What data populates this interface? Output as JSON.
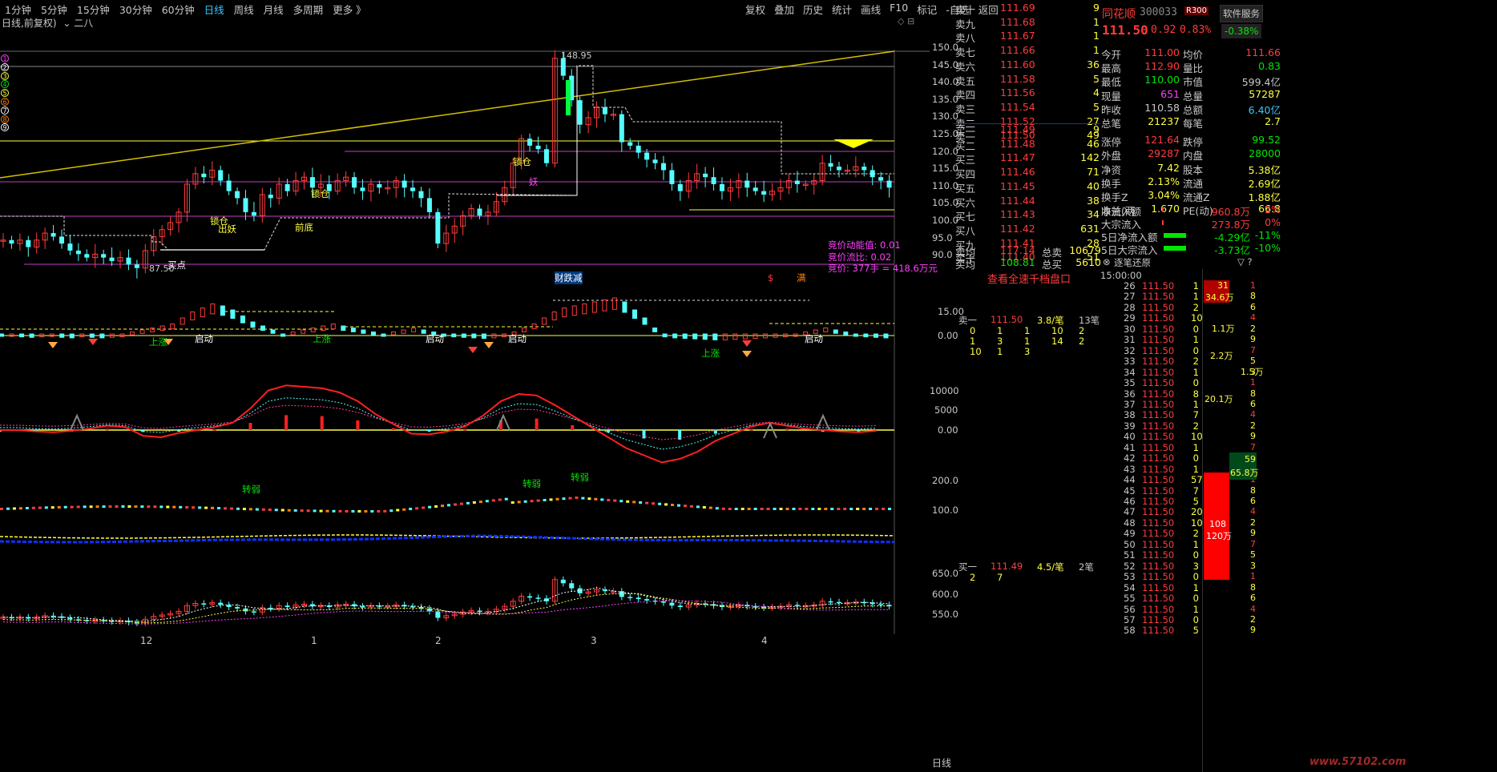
{
  "periods": [
    "1分钟",
    "5分钟",
    "15分钟",
    "30分钟",
    "60分钟",
    "日线",
    "周线",
    "月线",
    "多周期",
    "更多 》"
  ],
  "active_period": "日线",
  "right_tools": [
    "复权",
    "叠加",
    "历史",
    "统计",
    "画线",
    "F10",
    "标记",
    "-自选",
    "返回"
  ],
  "subtitle": "日线,前复权)",
  "formula": "二八",
  "main_y": [
    "150.0",
    "145.0",
    "140.0",
    "135.0",
    "130.0",
    "125.0",
    "120.0",
    "115.0",
    "110.0",
    "105.0",
    "100.0",
    "95.0",
    "90.0"
  ],
  "ind1_y": [
    "15.00",
    "0.00"
  ],
  "ind2_y": [
    "10000",
    "5000",
    "0.00"
  ],
  "ind3_y": [
    "200.0",
    "100.0"
  ],
  "ind4_y": [
    "650.0",
    "600.0",
    "550.0"
  ],
  "x_labels": [
    "12",
    "1",
    "2",
    "3",
    "4"
  ],
  "bottom_label": "日线",
  "numbers_legend": [
    "1",
    "2",
    "3",
    "4",
    "5",
    "6",
    "7",
    "8",
    "9"
  ],
  "annotations": {
    "high_price": "148.95",
    "low_price": "87.50",
    "buy_point": "买点",
    "lock1": "锁仓",
    "out1": "出妖",
    "front_bottom": "前底",
    "lock2": "锁仓",
    "lock3": "锁仓",
    "qiyao": "妖",
    "ind_energy": "竞价动能值: 0.01",
    "ind_ratio": "竞价流比: 0.02",
    "ind_amount": "竞价: 377手 = 418.6万元",
    "caitiao": "财跌减",
    "s_mark": "$",
    "dian": "满",
    "start1": "启动",
    "start2": "启动",
    "start3": "启动",
    "start4": "启动",
    "up": "上涨",
    "zhuanruo": "转弱"
  },
  "sell_rows": [
    {
      "label": "卖十",
      "price": "111.69",
      "vol": "9"
    },
    {
      "label": "卖九",
      "price": "111.68",
      "vol": "1"
    },
    {
      "label": "卖八",
      "price": "111.67",
      "vol": "1"
    },
    {
      "label": "卖七",
      "price": "111.66",
      "vol": "1"
    },
    {
      "label": "卖六",
      "price": "111.60",
      "vol": "36"
    },
    {
      "label": "卖五",
      "price": "111.58",
      "vol": "5"
    },
    {
      "label": "卖四",
      "price": "111.56",
      "vol": "4"
    },
    {
      "label": "卖三",
      "price": "111.54",
      "vol": "5"
    },
    {
      "label": "卖二",
      "price": "111.52",
      "vol": "27"
    },
    {
      "label": "卖一",
      "price": "111.50",
      "vol": "49"
    }
  ],
  "buy_rows": [
    {
      "label": "买一",
      "price": "111.49",
      "vol": "9"
    },
    {
      "label": "买二",
      "price": "111.48",
      "vol": "46"
    },
    {
      "label": "买三",
      "price": "111.47",
      "vol": "142"
    },
    {
      "label": "买四",
      "price": "111.46",
      "vol": "71"
    },
    {
      "label": "买五",
      "price": "111.45",
      "vol": "40"
    },
    {
      "label": "买六",
      "price": "111.44",
      "vol": "38"
    },
    {
      "label": "买七",
      "price": "111.43",
      "vol": "34"
    },
    {
      "label": "买八",
      "price": "111.42",
      "vol": "631"
    },
    {
      "label": "买九",
      "price": "111.41",
      "vol": "28"
    },
    {
      "label": "买十",
      "price": "111.40",
      "vol": "51"
    }
  ],
  "avg_rows": [
    {
      "label": "卖均",
      "price": "117.14",
      "k": "总卖",
      "v": "10679"
    },
    {
      "label": "买均",
      "price": "108.81",
      "k": "总买",
      "v": "5610"
    }
  ],
  "full_depth_link": "查看全速千档盘口",
  "queue_sell": {
    "label": "卖一",
    "price": "111.50",
    "per": "3.8/笔",
    "count": "13笔",
    "nums": [
      "0",
      "1",
      "1",
      "10",
      "2",
      "1",
      "3",
      "1",
      "14",
      "2",
      "10",
      "1",
      "3"
    ]
  },
  "queue_buy": {
    "label": "买一",
    "price": "111.49",
    "per": "4.5/笔",
    "count": "2笔",
    "nums": [
      "2",
      "7"
    ]
  },
  "stock": {
    "name": "同花顺",
    "code": "300033",
    "badge": "R300",
    "soft": "软件服务",
    "soft_chg": "-0.38%",
    "price": "111.50",
    "chg": "0.92",
    "pct": "0.83%"
  },
  "info": [
    {
      "k": "今开",
      "a": "111.00",
      "k2": "均价",
      "b": "111.66",
      "ac": "#ff3c3c",
      "bc": "#ff3c3c"
    },
    {
      "k": "最高",
      "a": "112.90",
      "k2": "量比",
      "b": "0.83",
      "ac": "#ff3c3c",
      "bc": "#00e600"
    },
    {
      "k": "最低",
      "a": "110.00",
      "k2": "市值",
      "b": "599.4亿",
      "ac": "#00e600",
      "bc": "#c8c8c8"
    },
    {
      "k": "现量",
      "a": "651",
      "k2": "总量",
      "b": "57287",
      "ac": "#ff40ff",
      "bc": "#ffff40"
    },
    {
      "k": "昨收",
      "a": "110.58",
      "k2": "总额",
      "b": "6.40亿",
      "ac": "#c8c8c8",
      "bc": "#3cc8ff"
    },
    {
      "k": "总笔",
      "a": "21237",
      "k2": "每笔",
      "b": "2.7",
      "ac": "#ffff40",
      "bc": "#ffff40"
    },
    {
      "k": "涨停",
      "a": "121.64",
      "k2": "跌停",
      "b": "99.52",
      "ac": "#ff3c3c",
      "bc": "#00e600"
    },
    {
      "k": "外盘",
      "a": "29287",
      "k2": "内盘",
      "b": "28000",
      "ac": "#ff3c3c",
      "bc": "#00e600"
    },
    {
      "k": "净资",
      "a": "7.42",
      "k2": "股本",
      "b": "5.38亿",
      "ac": "#ffff40",
      "bc": "#ffff40"
    },
    {
      "k": "换手",
      "a": "2.13%",
      "k2": "流通",
      "b": "2.69亿",
      "ac": "#ffff40",
      "bc": "#ffff40"
    },
    {
      "k": "换手Z",
      "a": "3.04%",
      "k2": "流通Z",
      "b": "1.88亿",
      "ac": "#ffff40",
      "bc": "#ffff40"
    },
    {
      "k": "收益(两",
      "a": "1.670",
      "k2": "PE(动)",
      "b": "66.8",
      "ac": "#ffff40",
      "bc": "#ffff40"
    }
  ],
  "flows": [
    {
      "k": "净流入额",
      "v": "960.8万",
      "p": "2%",
      "c": "#ff3c3c"
    },
    {
      "k": "大宗流入",
      "v": "273.8万",
      "p": "0%",
      "c": "#ff3c3c"
    },
    {
      "k": "5日净流入额",
      "v": "-4.29亿",
      "p": "-11%",
      "c": "#00e600"
    },
    {
      "k": "5日大宗流入",
      "v": "-3.73亿",
      "p": "-10%",
      "c": "#00e600"
    }
  ],
  "ticks_header": "逐笔还原",
  "tick_first_time": "15:00:00",
  "ticks": [
    "26",
    "27",
    "28",
    "29",
    "30",
    "31",
    "32",
    "33",
    "34",
    "35",
    "36",
    "37",
    "38",
    "39",
    "40",
    "41",
    "42",
    "43",
    "44",
    "45",
    "46",
    "47",
    "48",
    "49",
    "50",
    "51",
    "52",
    "53",
    "54",
    "55",
    "56",
    "57",
    "58"
  ],
  "tick_price": "111.50",
  "tick_vols": [
    "1",
    "1",
    "2",
    "10",
    "0",
    "1",
    "0",
    "2",
    "1",
    "0",
    "8",
    "1",
    "7",
    "2",
    "10",
    "1",
    "0",
    "1",
    "57",
    "7",
    "5",
    "20",
    "10",
    "2",
    "1",
    "0",
    "3",
    "0",
    "1",
    "0",
    "1",
    "0",
    "5"
  ],
  "side_nums": [
    {
      "v": "31",
      "t": "34.6万"
    },
    {
      "v": "1.1万",
      "t": ""
    },
    {
      "v": "2.2万",
      "t": ""
    },
    {
      "v": "1.5万",
      "t": ""
    },
    {
      "v": "20.1万",
      "t": ""
    },
    {
      "v": "59",
      "t": "65.8万"
    },
    {
      "v": "108",
      "t": "120万"
    }
  ],
  "watermark": "www.57102.com"
}
